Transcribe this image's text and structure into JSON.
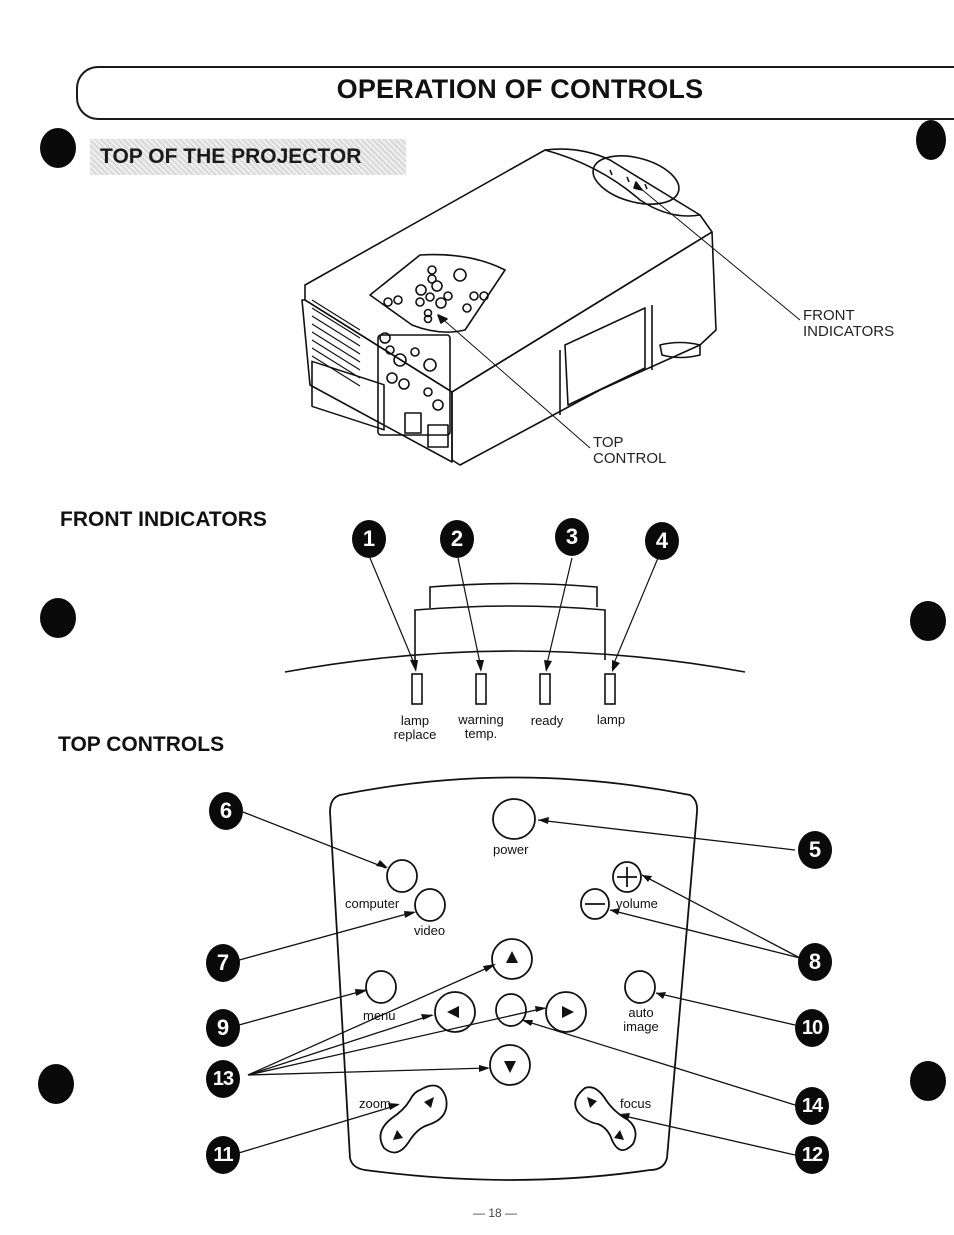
{
  "page": {
    "title": "OPERATION OF CONTROLS",
    "section_title": "TOP OF THE PROJECTOR",
    "page_number": "— 18 —"
  },
  "projector_figure": {
    "callouts": {
      "front_indicators_line1": "FRONT",
      "front_indicators_line2": "INDICATORS",
      "top_control_line1": "TOP",
      "top_control_line2": "CONTROL"
    }
  },
  "front_indicators": {
    "heading": "FRONT INDICATORS",
    "items": [
      {
        "number": "1",
        "label_line1": "lamp",
        "label_line2": "replace"
      },
      {
        "number": "2",
        "label_line1": "warning",
        "label_line2": "temp."
      },
      {
        "number": "3",
        "label_line1": "ready",
        "label_line2": ""
      },
      {
        "number": "4",
        "label_line1": "lamp",
        "label_line2": ""
      }
    ]
  },
  "top_controls": {
    "heading": "TOP CONTROLS",
    "buttons": {
      "power": "power",
      "computer": "computer",
      "video": "video",
      "volume": "volume",
      "menu": "menu",
      "auto_image_line1": "auto",
      "auto_image_line2": "image",
      "zoom": "zoom",
      "focus": "focus"
    },
    "callout_numbers": {
      "power": "5",
      "computer": "6",
      "video": "7",
      "volume": "8",
      "menu": "9",
      "auto_image": "10",
      "zoom": "11",
      "focus": "12",
      "arrows": "13",
      "select": "14"
    }
  }
}
